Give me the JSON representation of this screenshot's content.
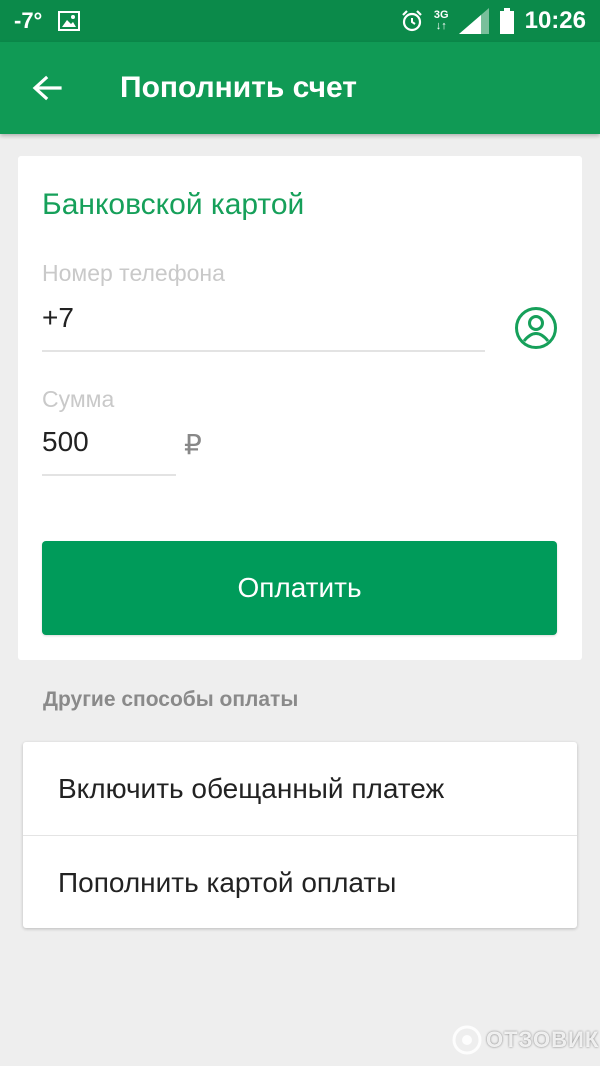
{
  "status_bar": {
    "temperature": "-7°",
    "network": "3G",
    "time": "10:26"
  },
  "app_bar": {
    "title": "Пополнить счет"
  },
  "payment_card": {
    "title": "Банковской картой",
    "phone": {
      "label": "Номер телефона",
      "value": "+7"
    },
    "amount": {
      "label": "Сумма",
      "value": "500",
      "currency_symbol": "₽"
    },
    "pay_button_label": "Оплатить"
  },
  "other_methods": {
    "title": "Другие способы оплаты",
    "items": [
      {
        "label": "Включить обещанный платеж"
      },
      {
        "label": "Пополнить картой оплаты"
      }
    ]
  },
  "watermark": {
    "text": "ОТЗОВИК"
  },
  "colors": {
    "status_bar": "#0b8a4a",
    "app_bar": "#109a55",
    "accent": "#16a05a",
    "button": "#009b5a"
  }
}
